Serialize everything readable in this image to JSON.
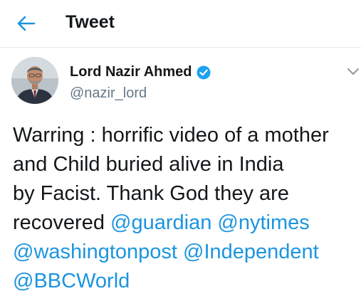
{
  "header": {
    "back_icon": "arrow-left-icon",
    "title": "Tweet"
  },
  "author": {
    "avatar_icon": "profile-photo",
    "display_name": "Lord Nazir Ahmed",
    "verified_icon": "verified-badge-icon",
    "handle": "@nazir_lord",
    "menu_icon": "chevron-down-icon"
  },
  "tweet": {
    "line1": "Warring : horrific video of a mother",
    "line2": "and Child buried alive in India",
    "line3": "by Facist. Thank God they are",
    "line4_text": "recovered ",
    "mentions": [
      "@guardian",
      "@nytimes",
      "@washingtonpost",
      "@Independent",
      "@BBCWorld"
    ]
  },
  "colors": {
    "accent": "#1b95e0",
    "text": "#14171a",
    "secondary": "#657786"
  }
}
